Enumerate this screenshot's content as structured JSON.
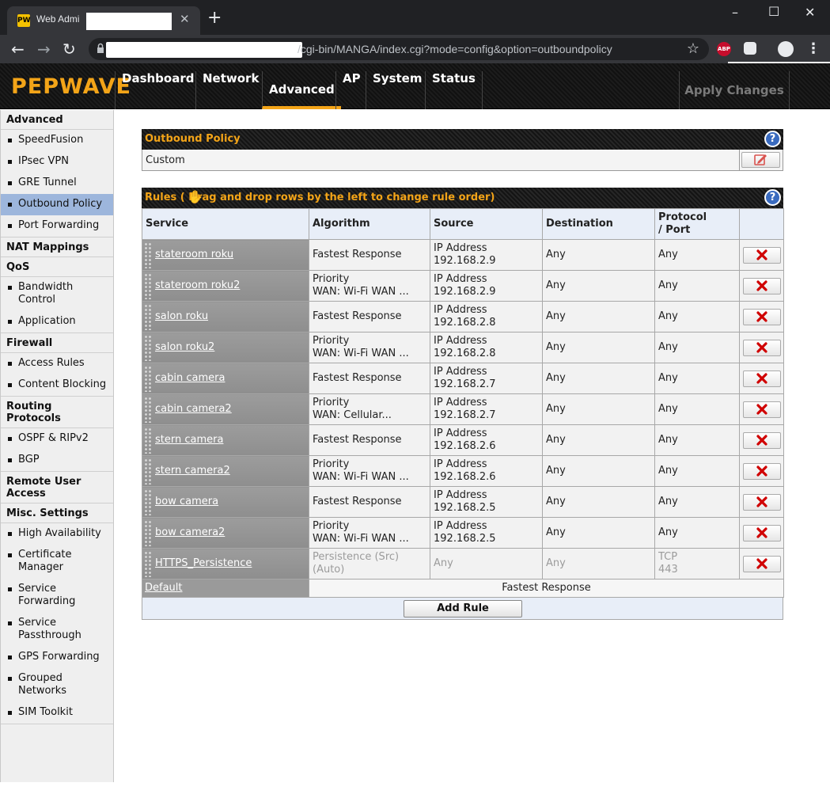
{
  "browser": {
    "tab_title": "Web Admi",
    "tab_close": "✕",
    "new_tab": "+",
    "url_visible": "/cgi-bin/MANGA/index.cgi?mode=config&option=outboundpolicy",
    "abp_label": "ABP",
    "favicon_label": "PW"
  },
  "header": {
    "brand": "PEPWAVE",
    "nav": [
      "Dashboard",
      "Network",
      "Advanced",
      "AP",
      "System",
      "Status"
    ],
    "active_nav": "Advanced",
    "apply_changes": "Apply Changes"
  },
  "sidebar": [
    {
      "section": "Advanced",
      "items": [
        "SpeedFusion",
        "IPsec VPN",
        "GRE Tunnel",
        "Outbound Policy",
        "Port Forwarding"
      ]
    },
    {
      "section": "NAT Mappings",
      "items": []
    },
    {
      "section": "QoS",
      "items": [
        "Bandwidth Control",
        "Application"
      ]
    },
    {
      "section": "Firewall",
      "items": [
        "Access Rules",
        "Content Blocking"
      ]
    },
    {
      "section": "Routing Protocols",
      "items": [
        "OSPF & RIPv2",
        "BGP"
      ]
    },
    {
      "section": "Remote User Access",
      "items": []
    },
    {
      "section": "Misc. Settings",
      "items": [
        "High Availability",
        "Certificate Manager",
        "Service Forwarding",
        "Service Passthrough",
        "GPS Forwarding",
        "Grouped Networks",
        "SIM Toolkit"
      ]
    }
  ],
  "sidebar_active": "Outbound Policy",
  "outbound_policy": {
    "title": "Outbound Policy",
    "help": "?",
    "mode": "Custom"
  },
  "rules": {
    "title": "Rules ( Drag and drop rows by the left to change rule order)",
    "help": "?",
    "headers": [
      "Service",
      "Algorithm",
      "Source",
      "Destination",
      "Protocol / Port",
      ""
    ],
    "header_protocol_line1": "Protocol",
    "header_protocol_line2": "/ Port",
    "rows": [
      {
        "service": "stateroom roku",
        "algo1": "Fastest Response",
        "algo2": "",
        "src1": "IP Address",
        "src2": "192.168.2.9",
        "dest": "Any",
        "proto1": "Any",
        "proto2": "",
        "muted": false
      },
      {
        "service": "stateroom roku2",
        "algo1": "Priority",
        "algo2": "WAN: Wi-Fi WAN ...",
        "src1": "IP Address",
        "src2": "192.168.2.9",
        "dest": "Any",
        "proto1": "Any",
        "proto2": "",
        "muted": false
      },
      {
        "service": "salon roku",
        "algo1": "Fastest Response",
        "algo2": "",
        "src1": "IP Address",
        "src2": "192.168.2.8",
        "dest": "Any",
        "proto1": "Any",
        "proto2": "",
        "muted": false
      },
      {
        "service": "salon roku2",
        "algo1": "Priority",
        "algo2": "WAN: Wi-Fi WAN ...",
        "src1": "IP Address",
        "src2": "192.168.2.8",
        "dest": "Any",
        "proto1": "Any",
        "proto2": "",
        "muted": false
      },
      {
        "service": "cabin camera",
        "algo1": "Fastest Response",
        "algo2": "",
        "src1": "IP Address",
        "src2": "192.168.2.7",
        "dest": "Any",
        "proto1": "Any",
        "proto2": "",
        "muted": false
      },
      {
        "service": "cabin camera2",
        "algo1": "Priority",
        "algo2": "WAN: Cellular...",
        "src1": "IP Address",
        "src2": "192.168.2.7",
        "dest": "Any",
        "proto1": "Any",
        "proto2": "",
        "muted": false
      },
      {
        "service": "stern camera",
        "algo1": "Fastest Response",
        "algo2": "",
        "src1": "IP Address",
        "src2": "192.168.2.6",
        "dest": "Any",
        "proto1": "Any",
        "proto2": "",
        "muted": false
      },
      {
        "service": "stern camera2",
        "algo1": "Priority",
        "algo2": "WAN: Wi-Fi WAN ...",
        "src1": "IP Address",
        "src2": "192.168.2.6",
        "dest": "Any",
        "proto1": "Any",
        "proto2": "",
        "muted": false
      },
      {
        "service": "bow camera",
        "algo1": "Fastest Response",
        "algo2": "",
        "src1": "IP Address",
        "src2": "192.168.2.5",
        "dest": "Any",
        "proto1": "Any",
        "proto2": "",
        "muted": false
      },
      {
        "service": "bow camera2",
        "algo1": "Priority",
        "algo2": "WAN: Wi-Fi WAN ...",
        "src1": "IP Address",
        "src2": "192.168.2.5",
        "dest": "Any",
        "proto1": "Any",
        "proto2": "",
        "muted": false
      },
      {
        "service": "HTTPS_Persistence",
        "algo1": "Persistence (Src)",
        "algo2": "(Auto)",
        "src1": "Any",
        "src2": "",
        "dest": "Any",
        "proto1": "TCP",
        "proto2": "443",
        "muted": true
      }
    ],
    "default_label": "Default",
    "default_algorithm": "Fastest Response",
    "add_rule": "Add Rule"
  },
  "colors": {
    "brand": "#f3a418",
    "delete_x": "#d00000",
    "sidebar_active": "#9db6dc",
    "header_row": "#e8eef8"
  }
}
